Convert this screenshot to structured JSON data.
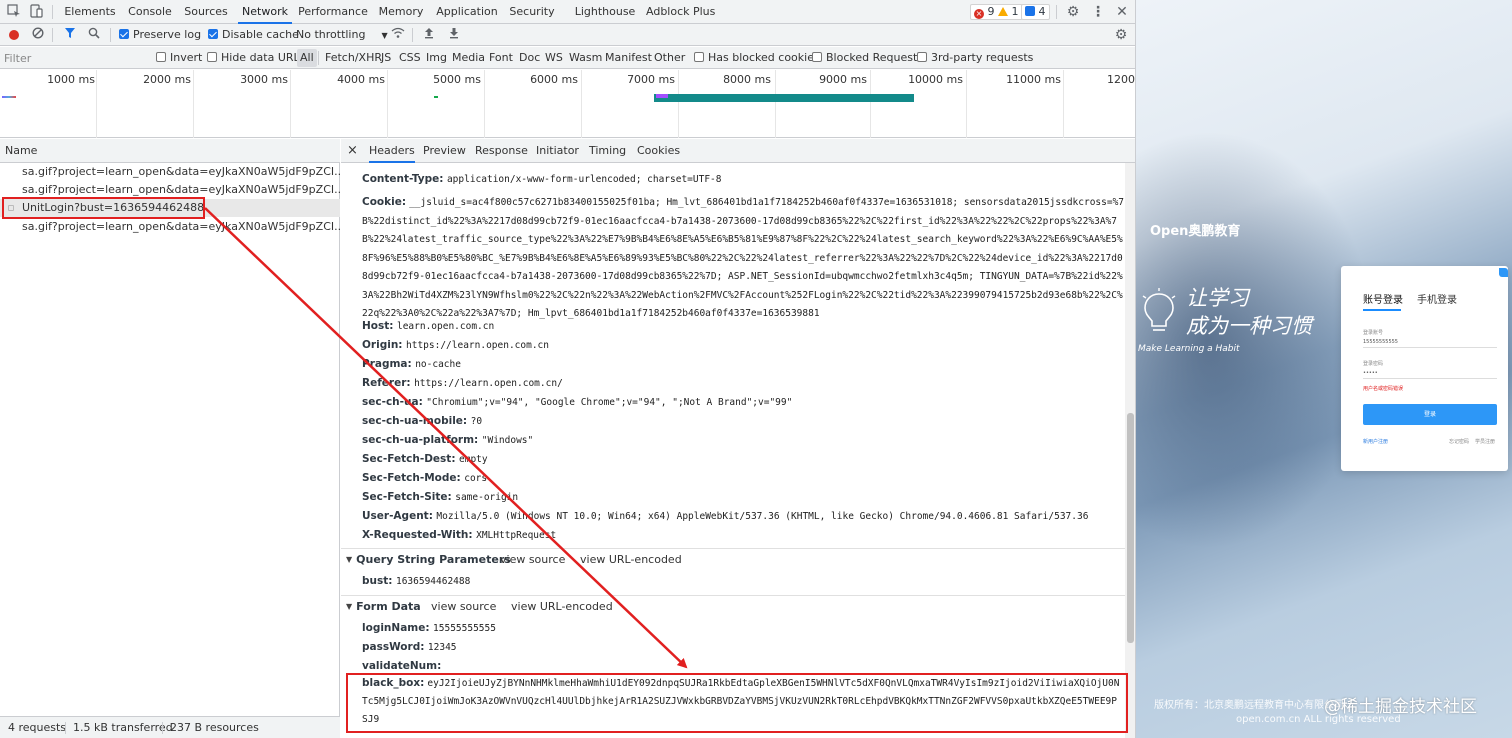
{
  "devtools": {
    "tabs": [
      "Elements",
      "Console",
      "Sources",
      "Network",
      "Performance",
      "Memory",
      "Application",
      "Security",
      "Lighthouse",
      "Adblock Plus"
    ],
    "active_tab": "Network",
    "errors_count": "9",
    "warnings_count": "1",
    "messages_count": "4"
  },
  "toolbar": {
    "preserve_log": "Preserve log",
    "disable_cache": "Disable cache",
    "throttling": "No throttling"
  },
  "filterbar": {
    "filter_placeholder": "Filter",
    "invert": "Invert",
    "hide_data_urls": "Hide data URLs",
    "types": [
      "All",
      "Fetch/XHR",
      "JS",
      "CSS",
      "Img",
      "Media",
      "Font",
      "Doc",
      "WS",
      "Wasm",
      "Manifest",
      "Other"
    ],
    "has_blocked_cookies": "Has blocked cookies",
    "blocked_requests": "Blocked Requests",
    "third_party": "3rd-party requests"
  },
  "overview": {
    "ticks": [
      "1000 ms",
      "2000 ms",
      "3000 ms",
      "4000 ms",
      "5000 ms",
      "6000 ms",
      "7000 ms",
      "8000 ms",
      "9000 ms",
      "10000 ms",
      "11000 ms",
      "1200"
    ]
  },
  "requests": {
    "column_name": "Name",
    "rows": [
      "sa.gif?project=learn_open&data=eyJkaXN0aW5jdF9pZCI...a19pZCI...",
      "sa.gif?project=learn_open&data=eyJkaXN0aW5jdF9pZCI...3RyYW...",
      "UnitLogin?bust=1636594462488",
      "sa.gif?project=learn_open&data=eyJkaXN0aW5jdF9pZCI...l90cmFj..."
    ],
    "selected_index": 2,
    "status_requests": "4 requests",
    "status_transferred": "1.5 kB transferred",
    "status_resources": "237 B resources"
  },
  "details": {
    "close": "×",
    "tabs": [
      "Headers",
      "Preview",
      "Response",
      "Initiator",
      "Timing",
      "Cookies"
    ],
    "active_tab": "Headers",
    "headers": {
      "content_type_key": "Content-Type:",
      "content_type_val": "application/x-www-form-urlencoded; charset=UTF-8",
      "cookie_key": "Cookie:",
      "cookie_val": "__jsluid_s=ac4f800c57c6271b83400155025f01ba; Hm_lvt_686401bd1a1f7184252b460af0f4337e=1636531018; sensorsdata2015jssdkcross=%7B%22distinct_id%22%3A%2217d08d99cb72f9-01ec16aacfcca4-b7a1438-2073600-17d08d99cb8365%22%2C%22first_id%22%3A%22%22%2C%22props%22%3A%7B%22%24latest_traffic_source_type%22%3A%22%E7%9B%B4%E6%8E%A5%E6%B5%81%E9%87%8F%22%2C%22%24latest_search_keyword%22%3A%22%E6%9C%AA%E5%8F%96%E5%88%B0%E5%80%BC_%E7%9B%B4%E6%8E%A5%E6%89%93%E5%BC%80%22%2C%22%24latest_referrer%22%3A%22%22%7D%2C%22%24device_id%22%3A%2217d08d99cb72f9-01ec16aacfcca4-b7a1438-2073600-17d08d99cb8365%22%7D; ASP.NET_SessionId=ubqwmcchwo2fetmlxh3c4q5m; TINGYUN_DATA=%7B%22id%22%3A%22Bh2WiTd4XZM%23lYN9Wfhslm0%22%2C%22n%22%3A%22WebAction%2FMVC%2FAccount%252FLogin%22%2C%22tid%22%3A%22399079415725b2d93e68b%22%2C%22q%22%3A0%2C%22a%22%3A7%7D; Hm_lpvt_686401bd1a1f7184252b460af0f4337e=1636539881",
      "host_key": "Host:",
      "host_val": "learn.open.com.cn",
      "origin_key": "Origin:",
      "origin_val": "https://learn.open.com.cn",
      "pragma_key": "Pragma:",
      "pragma_val": "no-cache",
      "referer_key": "Referer:",
      "referer_val": "https://learn.open.com.cn/",
      "secchua_key": "sec-ch-ua:",
      "secchua_val": "\"Chromium\";v=\"94\", \"Google Chrome\";v=\"94\", \";Not A Brand\";v=\"99\"",
      "secchuamobile_key": "sec-ch-ua-mobile:",
      "secchuamobile_val": "?0",
      "secchuaplatform_key": "sec-ch-ua-platform:",
      "secchuaplatform_val": "\"Windows\"",
      "secfetchdest_key": "Sec-Fetch-Dest:",
      "secfetchdest_val": "empty",
      "secfetchmode_key": "Sec-Fetch-Mode:",
      "secfetchmode_val": "cors",
      "secfetchsite_key": "Sec-Fetch-Site:",
      "secfetchsite_val": "same-origin",
      "useragent_key": "User-Agent:",
      "useragent_val": "Mozilla/5.0 (Windows NT 10.0; Win64; x64) AppleWebKit/537.36 (KHTML, like Gecko) Chrome/94.0.4606.81 Safari/537.36",
      "xrequested_key": "X-Requested-With:",
      "xrequested_val": "XMLHttpRequest"
    },
    "query": {
      "title": "Query String Parameters",
      "view_source": "view source",
      "view_url_encoded": "view URL-encoded",
      "bust_key": "bust:",
      "bust_val": "1636594462488"
    },
    "form": {
      "title": "Form Data",
      "view_source": "view source",
      "view_url_encoded": "view URL-encoded",
      "login_key": "loginName:",
      "login_val": "15555555555",
      "pass_key": "passWord:",
      "pass_val": "12345",
      "validate_key": "validateNum:",
      "blackbox_key": "black_box:",
      "blackbox_val": "eyJ2IjoieUJyZjBYNnNHMklmeHhaWmhiU1dEY092dnpqSUJRa1RkbEdtaGpleXBGenI5WHNlVTc5dXF0QnVLQmxaTWR4VyIsIm9zIjoid2ViIiwiaXQiOjU0NTc5Mjg5LCJ0IjoiWmJoK3AzOWVnVUQzcHl4UUlDbjhkejArR1A2SUZJVWxkbGRBVDZaYVBMSjVKUzVUN2RkT0RLcEhpdVBKQkMxTTNnZGF2WFVVS0pxaUtkbXZQeE5TWEE9PSJ9"
    }
  },
  "webpage": {
    "logo": "Open奥鹏教育",
    "slogan1": "让学习",
    "slogan2": "成为一种习惯",
    "slogan3": "Make Learning a Habit",
    "login": {
      "tab_account": "账号登录",
      "tab_phone": "手机登录",
      "label_account": "登录账号",
      "account_value": "15555555555",
      "label_password": "登录密码",
      "password_value": "•••••",
      "error": "用户名或密码错误",
      "submit": "登录",
      "foot_register": "新用户注册",
      "foot_forgot": "忘记密码",
      "foot_help": "学员注册"
    },
    "footer1": "版权所有：北京奥鹏远程教育中心有限公司",
    "footer2": "open.com.cn ALL rights reserved",
    "watermark": "@稀土掘金技术社区"
  },
  "colors": {
    "accent": "#1a73e8",
    "annotation": "#e12020",
    "error_badge": "#d93025",
    "warning_badge": "#f9ab00",
    "message_badge": "#1a73e8",
    "login_button": "#2d97f7"
  }
}
